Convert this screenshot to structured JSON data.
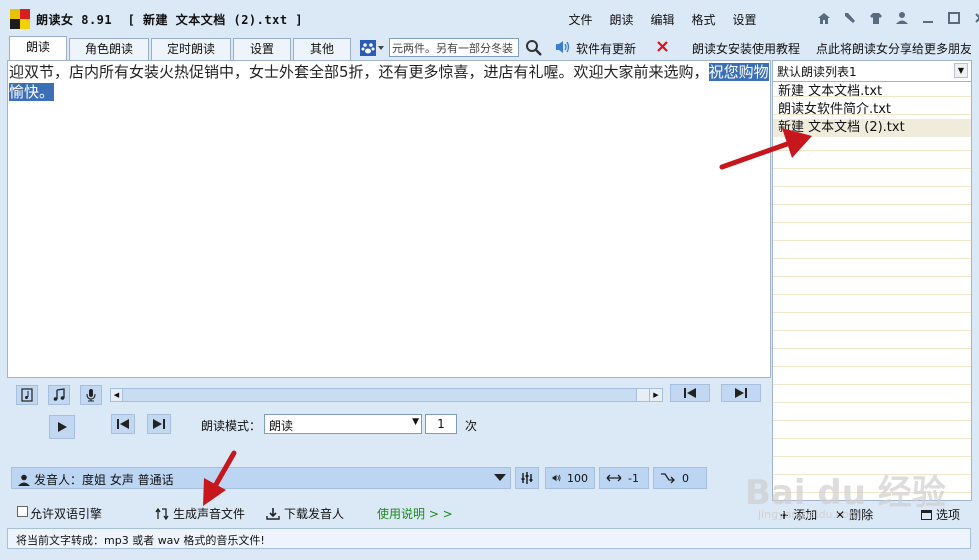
{
  "title_bar": {
    "app_title": "朗读女 8.91  [ 新建 文本文档 (2).txt ]",
    "menu": [
      "文件",
      "朗读",
      "编辑",
      "格式",
      "设置"
    ],
    "window_buttons": [
      "home-icon",
      "tools-icon",
      "shirt-icon",
      "user-icon",
      "minimize-icon",
      "maximize-icon",
      "close-icon"
    ]
  },
  "tabs": [
    {
      "label": "朗读",
      "active": true
    },
    {
      "label": "角色朗读"
    },
    {
      "label": "定时朗读"
    },
    {
      "label": "设置"
    },
    {
      "label": "其他"
    }
  ],
  "toolbar": {
    "search_value": "元两件。另有一部分冬装",
    "update_text": "软件有更新",
    "tutorial_link": "朗读女安装使用教程",
    "share_link": "点此将朗读女分享给更多朋友"
  },
  "editor": {
    "text_before": "迎双节，店内所有女装火热促销中，女士外套全部5折，还有更多惊喜，进店有礼喔。欢迎大家前来选购，",
    "text_selected": "祝您购物愉快。"
  },
  "playlist": {
    "selected_list": "默认朗读列表1",
    "items": [
      "新建 文本文档.txt",
      "朗读女软件简介.txt",
      "新建 文本文档 (2).txt"
    ],
    "active_index": 2,
    "add_label": "添加",
    "delete_label": "删除",
    "options_label": "选项"
  },
  "controls": {
    "mode_label": "朗读模式：",
    "mode_value": "朗读",
    "times_value": "1",
    "times_unit": "次",
    "speaker": "发音人：度姐 女声 普通话",
    "volume": "100",
    "speed": "-1",
    "pitch": "0",
    "bilingual_label": "允许双语引擎",
    "generate_label": "生成声音文件",
    "download_label": "下载发音人",
    "help_label": "使用说明 > >"
  },
  "status_bar": {
    "text": "将当前文字转成：mp3 或者 wav 格式的音乐文件!"
  },
  "watermark": {
    "logo": "Bai du 经验",
    "url": "jingyan.baidu.com"
  },
  "colors": {
    "background": "#dbe8f6",
    "selection": "#3b6fb6",
    "arrow": "#c8161d",
    "link_green": "#1a8c1a"
  }
}
